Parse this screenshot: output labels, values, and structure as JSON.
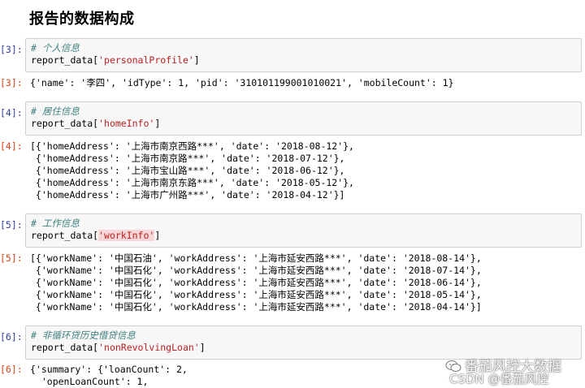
{
  "heading": "报告的数据构成",
  "cells": [
    {
      "in_prompt": "[3]:",
      "comment": "# 个人信息",
      "call_prefix": "report_data[",
      "key": "'personalProfile'",
      "call_suffix": "]",
      "out_prompt": "[3]:",
      "output_lines": [
        "{'name': '李四', 'idType': 1, 'pid': '310101199001010021', 'mobileCount': 1}"
      ]
    },
    {
      "in_prompt": "[4]:",
      "comment": "# 居住信息",
      "call_prefix": "report_data[",
      "key": "'homeInfo'",
      "call_suffix": "]",
      "out_prompt": "[4]:",
      "output_lines": [
        "[{'homeAddress': '上海市南京西路***', 'date': '2018-08-12'},",
        " {'homeAddress': '上海市南京路***', 'date': '2018-07-12'},",
        " {'homeAddress': '上海市宝山路***', 'date': '2018-06-12'},",
        " {'homeAddress': '上海市南京东路***', 'date': '2018-05-12'},",
        " {'homeAddress': '上海市广州路***', 'date': '2018-04-12'}]"
      ]
    },
    {
      "in_prompt": "[5]:",
      "comment": "# 工作信息",
      "call_prefix": "report_data[",
      "key": "'workInfo'",
      "call_suffix": "]",
      "out_prompt": "[5]:",
      "output_lines": [
        "[{'workName': '中国石油', 'workAddress': '上海市延安西路***', 'date': '2018-08-14'},",
        " {'workName': '中国石化', 'workAddress': '上海市延安西路***', 'date': '2018-07-14'},",
        " {'workName': '中国石化', 'workAddress': '上海市延安西路***', 'date': '2018-06-14'},",
        " {'workName': '中国石化', 'workAddress': '上海市延安西路***', 'date': '2018-05-14'},",
        " {'workName': '中国石化', 'workAddress': '上海市延安西路***', 'date': '2018-04-14'}]"
      ]
    },
    {
      "in_prompt": "[6]:",
      "comment": "# 非循环贷历史借贷信息",
      "call_prefix": "report_data[",
      "key": "'nonRevolvingLoan'",
      "call_suffix": "]",
      "out_prompt": "[6]:",
      "output_lines": [
        "{'summary': {'loanCount': 2,",
        "  'openLoanCount': 1,"
      ]
    }
  ],
  "watermark": {
    "wechat": "番茄风控大数据",
    "csdn": "CSDN @番茄风控"
  }
}
